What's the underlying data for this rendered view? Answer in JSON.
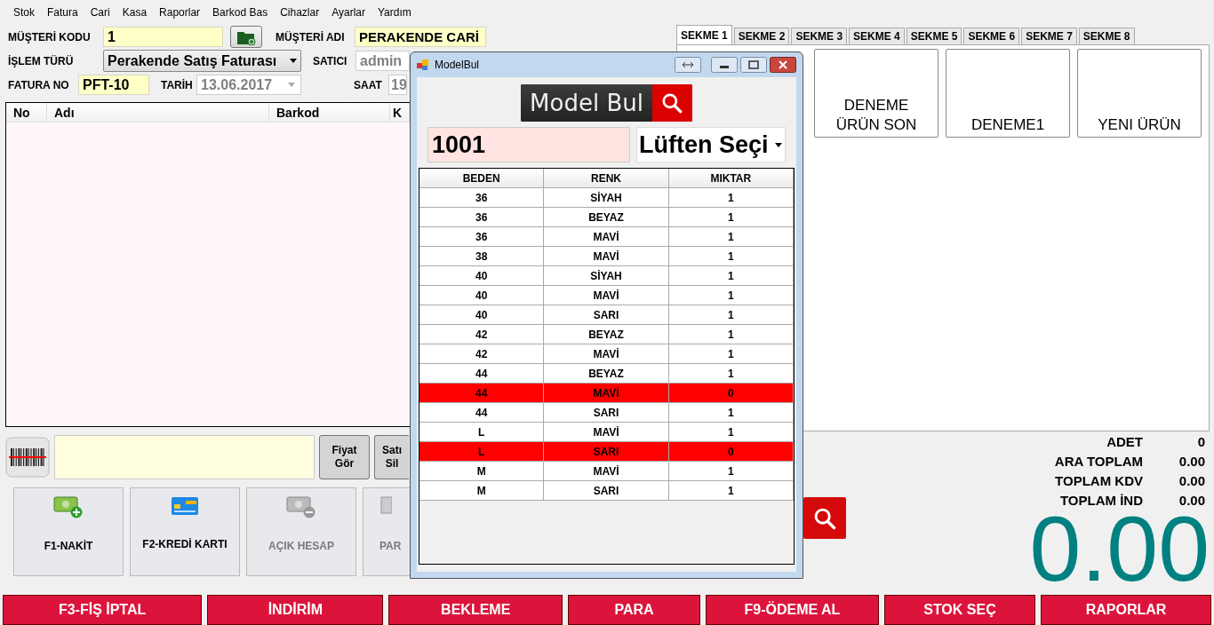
{
  "menu": [
    "Stok",
    "Fatura",
    "Cari",
    "Kasa",
    "Raporlar",
    "Barkod Bas",
    "Cihazlar",
    "Ayarlar",
    "Yardım"
  ],
  "form": {
    "customer_code": {
      "label": "MÜŞTERİ KODU",
      "value": "1"
    },
    "customer_name": {
      "label": "MÜŞTERİ ADI",
      "value": "PERAKENDE CARİ"
    },
    "transaction_type": {
      "label": "İŞLEM TÜRÜ",
      "value": "Perakende Satış Faturası"
    },
    "seller": {
      "label": "SATICI",
      "value": "admin",
      "disabled": true
    },
    "invoice_no": {
      "label": "FATURA NO",
      "value": "PFT-10"
    },
    "date": {
      "label": "TARİH",
      "value": "13.06.2017",
      "disabled": true
    },
    "time": {
      "label": "SAAT",
      "value": "19",
      "disabled": true
    }
  },
  "table": {
    "columns": [
      "No",
      "Adı",
      "Barkod",
      "K"
    ]
  },
  "scanner": {
    "buttons": [
      "Fiyat Gör",
      "Satı Sil"
    ]
  },
  "payments": [
    {
      "label": "F1-NAKİT",
      "kind": "cash",
      "disabled": false
    },
    {
      "label": "F2-KREDİ KARTI",
      "kind": "card",
      "disabled": false
    },
    {
      "label": "AÇIK HESAP",
      "kind": "account",
      "disabled": true
    },
    {
      "label": "PAR",
      "kind": "other",
      "disabled": true
    }
  ],
  "tabs": [
    {
      "label": "SEKME 1",
      "selected": true
    },
    {
      "label": "SEKME 2",
      "selected": false
    },
    {
      "label": "SEKME 3",
      "selected": false
    },
    {
      "label": "SEKME 4",
      "selected": false
    },
    {
      "label": "SEKME 5",
      "selected": false
    },
    {
      "label": "SEKME 6",
      "selected": false
    },
    {
      "label": "SEKME 7",
      "selected": false
    },
    {
      "label": "SEKME 8",
      "selected": false
    }
  ],
  "products": [
    "DENEME\nÜRÜN SON",
    "DENEME1",
    "YENI ÜRÜN"
  ],
  "totals": [
    {
      "label": "ADET",
      "value": "0"
    },
    {
      "label": "ARA TOPLAM",
      "value": "0.00"
    },
    {
      "label": "TOPLAM KDV",
      "value": "0.00"
    },
    {
      "label": "TOPLAM İND",
      "value": "0.00"
    }
  ],
  "grand_total": "0.00",
  "actions": [
    "F3-FİŞ İPTAL",
    "İNDİRİM",
    "BEKLEME",
    "PARA",
    "F9-ÖDEME AL",
    "STOK SEÇ",
    "RAPORLAR"
  ],
  "dialog": {
    "title": "ModelBul",
    "header_button": "Model Bul",
    "search_value": "1001",
    "dropdown": "Lüften Seçi",
    "columns": [
      "BEDEN",
      "RENK",
      "MIKTAR"
    ],
    "rows": [
      {
        "cells": [
          "36",
          "SİYAH",
          "1"
        ],
        "alert": false
      },
      {
        "cells": [
          "36",
          "BEYAZ",
          "1"
        ],
        "alert": false
      },
      {
        "cells": [
          "36",
          "MAVİ",
          "1"
        ],
        "alert": false
      },
      {
        "cells": [
          "38",
          "MAVİ",
          "1"
        ],
        "alert": false
      },
      {
        "cells": [
          "40",
          "SİYAH",
          "1"
        ],
        "alert": false
      },
      {
        "cells": [
          "40",
          "MAVİ",
          "1"
        ],
        "alert": false
      },
      {
        "cells": [
          "40",
          "SARI",
          "1"
        ],
        "alert": false
      },
      {
        "cells": [
          "42",
          "BEYAZ",
          "1"
        ],
        "alert": false
      },
      {
        "cells": [
          "42",
          "MAVİ",
          "1"
        ],
        "alert": false
      },
      {
        "cells": [
          "44",
          "BEYAZ",
          "1"
        ],
        "alert": false
      },
      {
        "cells": [
          "44",
          "MAVİ",
          "0"
        ],
        "alert": true
      },
      {
        "cells": [
          "44",
          "SARI",
          "1"
        ],
        "alert": false
      },
      {
        "cells": [
          "L",
          "MAVİ",
          "1"
        ],
        "alert": false
      },
      {
        "cells": [
          "L",
          "SARI",
          "0"
        ],
        "alert": true
      },
      {
        "cells": [
          "M",
          "MAVİ",
          "1"
        ],
        "alert": false
      },
      {
        "cells": [
          "M",
          "SARI",
          "1"
        ],
        "alert": false
      }
    ]
  }
}
